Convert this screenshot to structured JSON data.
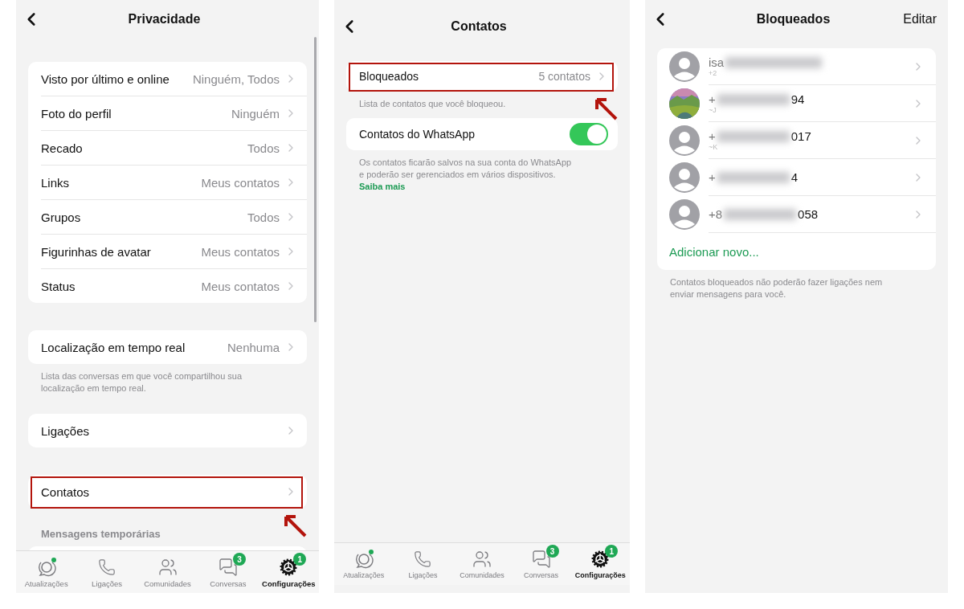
{
  "screens": [
    {
      "kind": "settings",
      "title": "Privacidade",
      "scrollbar": true,
      "sections": [
        {
          "rows": [
            {
              "label": "Visto por último e online",
              "value": "Ninguém, Todos",
              "highlighted": false
            },
            {
              "label": "Foto do perfil",
              "value": "Ninguém",
              "highlighted": false
            },
            {
              "label": "Recado",
              "value": "Todos",
              "highlighted": false
            },
            {
              "label": "Links",
              "value": "Meus contatos",
              "highlighted": false
            },
            {
              "label": "Grupos",
              "value": "Todos",
              "highlighted": false
            },
            {
              "label": "Figurinhas de avatar",
              "value": "Meus contatos",
              "highlighted": false
            },
            {
              "label": "Status",
              "value": "Meus contatos",
              "highlighted": false
            }
          ]
        },
        {
          "rows": [
            {
              "label": "Localização em tempo real",
              "value": "Nenhuma",
              "highlighted": false
            }
          ],
          "footnote": "Lista das conversas em que você compartilhou sua localização em tempo real."
        },
        {
          "rows": [
            {
              "label": "Ligações",
              "highlighted": false
            }
          ]
        },
        {
          "rows": [
            {
              "label": "Contatos",
              "highlighted": true
            }
          ]
        },
        {
          "header": "Mensagens temporárias"
        }
      ],
      "tab_bar": [
        {
          "label": "Atualizações",
          "selected": false,
          "dot": true
        },
        {
          "label": "Ligações",
          "selected": false,
          "dot": false
        },
        {
          "label": "Comunidades",
          "selected": false,
          "dot": false
        },
        {
          "label": "Conversas",
          "selected": false,
          "dot": false,
          "badge": "3"
        },
        {
          "label": "Configurações",
          "selected": true,
          "dot": false,
          "badge": "1"
        }
      ]
    },
    {
      "kind": "settings",
      "title": "Contatos",
      "sections": [
        {
          "rows": [
            {
              "label": "Bloqueados",
              "value": "5 contatos",
              "highlighted": true
            }
          ],
          "footnote": "Lista de contatos que você bloqueou."
        },
        {
          "rows": [
            {
              "label": "Contatos do WhatsApp",
              "kind": "toggle",
              "on": true,
              "highlighted": false
            }
          ],
          "footnote": "Os contatos ficarão salvos na sua conta do WhatsApp e poderão ser gerenciados em vários dispositivos.",
          "footnote_link": "Saiba mais"
        }
      ],
      "tab_bar": [
        {
          "label": "Atualizações",
          "selected": false,
          "dot": true
        },
        {
          "label": "Ligações",
          "selected": false,
          "dot": false
        },
        {
          "label": "Comunidades",
          "selected": false,
          "dot": false
        },
        {
          "label": "Conversas",
          "selected": false,
          "dot": false,
          "badge": "3"
        },
        {
          "label": "Configurações",
          "selected": true,
          "dot": false,
          "badge": "1"
        }
      ]
    },
    {
      "kind": "blocked",
      "title": "Bloqueados",
      "action": "Editar",
      "contacts": [
        {
          "photo": false,
          "head": "isa",
          "subtitle": "+2"
        },
        {
          "photo": true,
          "head": "+",
          "tail": "94",
          "subtitle": "~J"
        },
        {
          "photo": false,
          "head": "+",
          "tail": "017",
          "subtitle": "~K"
        },
        {
          "photo": false,
          "head": "+",
          "tail": "4"
        },
        {
          "photo": false,
          "head": "+8",
          "tail": "058"
        }
      ],
      "add_link": "Adicionar novo...",
      "footnote": "Contatos bloqueados não poderão fazer ligações nem enviar mensagens para você."
    }
  ]
}
